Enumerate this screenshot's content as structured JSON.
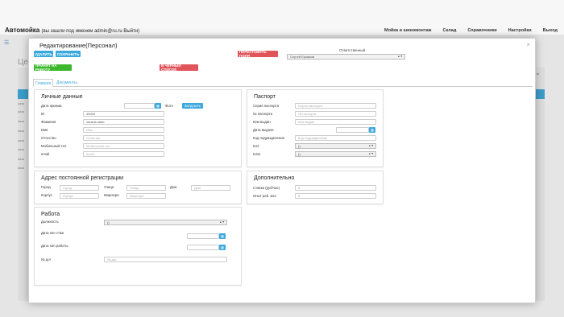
{
  "navbar": {
    "brand": "Автомойка",
    "login_text": "(вы зашли под именем admin@ru.ru Выйти)",
    "links": [
      "Мойка и шиномонтаж",
      "Склад",
      "Справочники",
      "Настройки",
      "Выход"
    ]
  },
  "background": {
    "title": "Це",
    "rows": [
      "каза",
      "каза",
      "каза",
      "каза",
      "каза",
      "каза",
      "каза",
      "каза"
    ]
  },
  "modal": {
    "title": "Редактирование(Персонал)",
    "close": "×",
    "buttons": {
      "delete": "УДАЛИТЬ",
      "save": "СОХРАНИТЬ",
      "hire": "ПРИНЯТ НА РАБОТУ",
      "rearrange": "ПЕРЕСТАВИТЬ ПОЛЯ",
      "blacklist": "В ЧЕРНЫЙ СПИСОК",
      "upload": "Загрузить"
    },
    "responsible": {
      "label": "Ответственный",
      "value": "Сергей Ермаков"
    },
    "tabs": [
      "Главная",
      "Документы"
    ],
    "personal": {
      "title": "Личные данные",
      "fields": {
        "hire_date": {
          "label": "Дата приема",
          "placeholder": ""
        },
        "photo": {
          "label": "Фото"
        },
        "id": {
          "label": "ID",
          "value": "40000"
        },
        "surname": {
          "label": "Фамилия",
          "value": "чипков иван"
        },
        "name": {
          "label": "Имя",
          "placeholder": "Имя"
        },
        "patronymic": {
          "label": "Отчество",
          "placeholder": "Отчество"
        },
        "mobile": {
          "label": "Мобильный тел",
          "placeholder": "Мобильный тел"
        },
        "email": {
          "label": "email",
          "placeholder": "email"
        }
      }
    },
    "passport": {
      "title": "Паспорт",
      "fields": {
        "series": {
          "label": "Серия паспорта",
          "placeholder": "Серия паспорта"
        },
        "number": {
          "label": "№ паспорта",
          "placeholder": "№ паспорта"
        },
        "issued_by": {
          "label": "Кем выдан",
          "placeholder": "Кем выдан"
        },
        "issue_date": {
          "label": "Дата выдачи",
          "placeholder": ""
        },
        "division_code": {
          "label": "Код подразделения",
          "placeholder": "Код подразделения"
        },
        "test": {
          "label": "test",
          "value": "()"
        },
        "test1": {
          "label": "test1",
          "value": "()"
        }
      }
    },
    "address": {
      "title": "Адрес постоянной регистрации",
      "city": {
        "label": "Город",
        "placeholder": "Город"
      },
      "street": {
        "label": "Улица",
        "placeholder": "Улица"
      },
      "house": {
        "label": "Дом",
        "placeholder": "Дом"
      },
      "building": {
        "label": "Корпус",
        "placeholder": "Корпус"
      },
      "apartment": {
        "label": "Квартира",
        "placeholder": "Квартира"
      }
    },
    "extra": {
      "title": "Дополнительно",
      "rate": {
        "label": "Ставка (руб/час)",
        "placeholder": "$"
      },
      "experience": {
        "label": "Опыт раб. мес",
        "placeholder": "$"
      }
    },
    "work": {
      "title": "Работа",
      "position": {
        "label": "Должность",
        "value": "()"
      },
      "start_experience": {
        "label": "Дата нач стаж",
        "placeholder": ""
      },
      "start_work": {
        "label": "Дата нач работы",
        "placeholder": ""
      },
      "contract": {
        "label": "№ дог",
        "placeholder": "№ дог"
      }
    }
  }
}
